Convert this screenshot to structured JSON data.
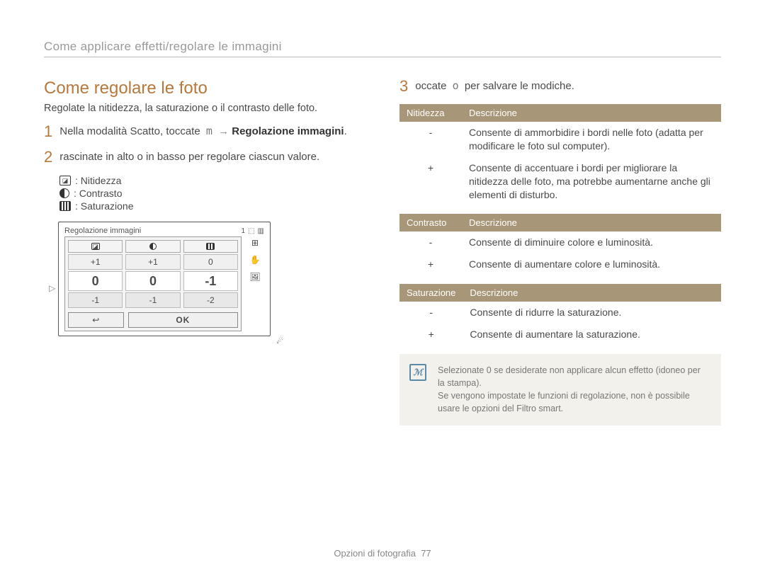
{
  "breadcrumb": "Come applicare effetti/regolare le immagini",
  "heading": "Come regolare le foto",
  "intro": "Regolate la nitidezza, la saturazione o il contrasto delle foto.",
  "steps": {
    "1": {
      "pre": "Nella modalità Scatto, toccate",
      "menu_glyph": "m",
      "arrow": "→",
      "bold": "Regolazione immagini",
      "post": "."
    },
    "2": {
      "text": "rascinate in alto o in basso per regolare ciascun valore."
    },
    "3": {
      "pre": "occate",
      "ok_glyph": "o",
      "post": "per salvare le modiche."
    }
  },
  "icon_list": {
    "nitidezza": "Nitidezza",
    "contrasto": "Contrasto",
    "saturazione": "Saturazione"
  },
  "device": {
    "title": "Regolazione immagini",
    "status_num": "1",
    "col_headers": [
      "",
      "",
      ""
    ],
    "rows": {
      "top": [
        "+1",
        "+1",
        "0"
      ],
      "mid": [
        "0",
        "0",
        "-1"
      ],
      "bottom": [
        "-1",
        "-1",
        "-2"
      ]
    },
    "side_icons": [
      "⊞",
      "✋",
      "🖼"
    ],
    "back_glyph": "↩",
    "ok_label": "OK",
    "corner_glyph": "☄"
  },
  "tables": {
    "nitidezza": {
      "header_left": "Nitidezza",
      "header_right": "Descrizione",
      "rows": [
        {
          "sym": "-",
          "desc": "Consente di ammorbidire i bordi nelle foto (adatta per modificare le foto sul computer)."
        },
        {
          "sym": "+",
          "desc": "Consente di accentuare i bordi per migliorare la nitidezza delle foto, ma potrebbe aumentarne anche gli elementi di disturbo."
        }
      ]
    },
    "contrasto": {
      "header_left": "Contrasto",
      "header_right": "Descrizione",
      "rows": [
        {
          "sym": "-",
          "desc": "Consente di diminuire colore e luminosità."
        },
        {
          "sym": "+",
          "desc": "Consente di aumentare colore e luminosità."
        }
      ]
    },
    "saturazione": {
      "header_left": "Saturazione",
      "header_right": "Descrizione",
      "rows": [
        {
          "sym": "-",
          "desc": "Consente di ridurre la saturazione."
        },
        {
          "sym": "+",
          "desc": "Consente di aumentare la saturazione."
        }
      ]
    }
  },
  "note": {
    "line1": "Selezionate 0 se desiderate non applicare alcun effetto (idoneo per la stampa).",
    "line2": "Se vengono impostate le funzioni di regolazione, non è possibile usare le opzioni del Filtro smart."
  },
  "footer": {
    "label": "Opzioni di fotografia",
    "page": "77"
  }
}
